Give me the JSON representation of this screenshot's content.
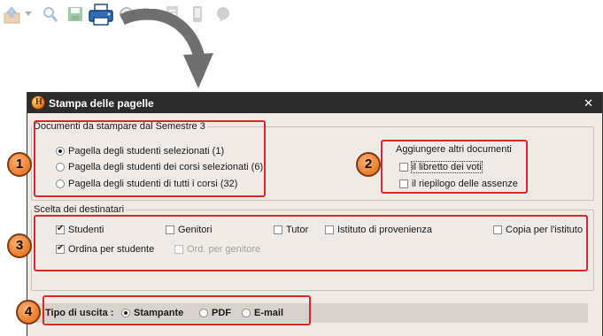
{
  "window": {
    "title": "Stampa delle pagelle",
    "close_symbol": "✕"
  },
  "documents": {
    "legend": "Documenti da stampare dal Semestre 3",
    "options": [
      {
        "label": "Pagella degli studenti selezionati (1)",
        "selected": true
      },
      {
        "label": "Pagella degli studenti dei corsi selezionati (6)",
        "selected": false
      },
      {
        "label": "Pagella degli studenti di tutti i corsi (32)",
        "selected": false
      }
    ]
  },
  "extra_docs": {
    "title": "Aggiungere altri documenti",
    "items": [
      {
        "label": "il libretto dei voti",
        "checked": false
      },
      {
        "label": "il riepilogo delle assenze",
        "checked": false
      }
    ]
  },
  "recipients": {
    "legend": "Scelta dei destinatari",
    "items": [
      {
        "label": "Studenti",
        "checked": true
      },
      {
        "label": "Genitori",
        "checked": false
      },
      {
        "label": "Tutor",
        "checked": false
      },
      {
        "label": "Istituto di provenienza",
        "checked": false
      },
      {
        "label": "Copia per l'istituto",
        "checked": false
      }
    ],
    "sort_by_student": {
      "label": "Ordina per studente",
      "checked": true
    },
    "sort_by_parent": {
      "label": "Ord. per genitore",
      "checked": false,
      "disabled": true
    }
  },
  "output": {
    "label": "Tipo di uscita :",
    "options": [
      {
        "label": "Stampante",
        "selected": true
      },
      {
        "label": "PDF",
        "selected": false
      },
      {
        "label": "E-mail",
        "selected": false
      }
    ]
  },
  "badges": [
    "1",
    "2",
    "3",
    "4"
  ],
  "colors": {
    "highlight_border": "#d9262a",
    "badge_fill": "#ee7f2d",
    "titlebar": "#2c2c2c",
    "window_bg": "#efeae6"
  },
  "toolbar_icons": [
    "upload-icon",
    "dropdown-arrow-icon",
    "search-icon",
    "save-icon",
    "printer-icon",
    "email-icon",
    "folder-icon",
    "document-icon",
    "mobile-icon",
    "chat-icon"
  ]
}
